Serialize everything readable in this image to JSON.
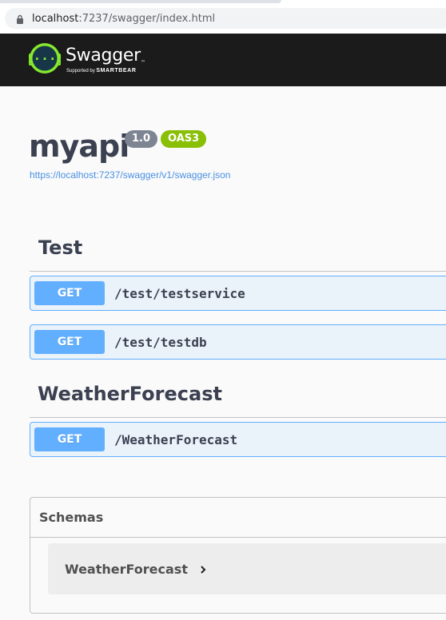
{
  "browser": {
    "url_host": "localhost",
    "url_path": ":7237/swagger/index.html"
  },
  "topbar": {
    "logo_title": "Swagger",
    "logo_sub_prefix": "Supported by ",
    "logo_sub_brand": "SMARTBEAR"
  },
  "info": {
    "title": "myapi",
    "version": "1.0",
    "oas": "OAS3",
    "spec_url": "https://localhost:7237/swagger/v1/swagger.json"
  },
  "tags": [
    {
      "name": "Test",
      "operations": [
        {
          "method": "GET",
          "path": "/test/testservice"
        },
        {
          "method": "GET",
          "path": "/test/testdb"
        }
      ]
    },
    {
      "name": "WeatherForecast",
      "operations": [
        {
          "method": "GET",
          "path": "/WeatherForecast"
        }
      ]
    }
  ],
  "schemas": {
    "title": "Schemas",
    "models": [
      {
        "name": "WeatherForecast"
      }
    ]
  },
  "colors": {
    "get": "#61affe",
    "topbar": "#1b1b1b",
    "logo_green": "#85ea2d",
    "oas_badge": "#89bf04",
    "version_badge": "#7d8492",
    "link": "#4990e2"
  },
  "icons": {
    "lock": "lock-icon",
    "logo": "swagger-logo-icon",
    "chevron": "chevron-right-icon"
  }
}
